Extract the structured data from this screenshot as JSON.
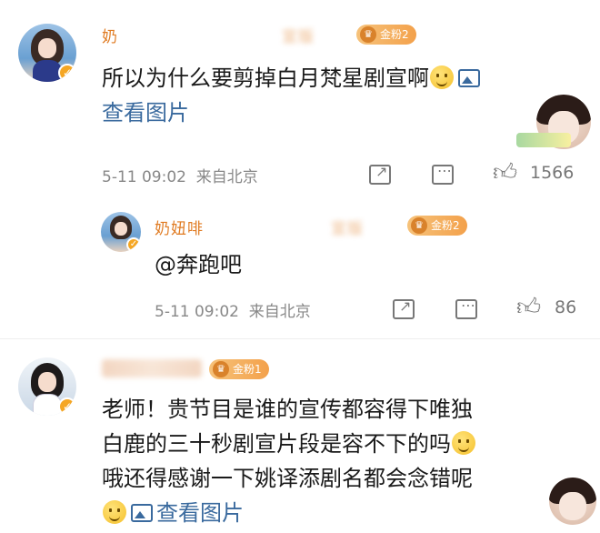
{
  "comments": [
    {
      "username": "奶",
      "username_hidden": "宣版",
      "fan_badge": "金粉2",
      "text": "所以为什么要剪掉白月梵星剧宣啊",
      "view_image": "查看图片",
      "time": "5-11 09:02",
      "source": "来自北京",
      "likes": "1566"
    },
    {
      "username": "奶妞啡",
      "username_hidden": "宣版",
      "fan_badge": "金粉2",
      "mention": "@奔跑吧",
      "time": "5-11 09:02",
      "source": "来自北京",
      "likes": "86"
    },
    {
      "username": "",
      "fan_badge": "金粉1",
      "line1": "老师！贵节目是谁的宣传都容得下唯独",
      "line2": "白鹿的三十秒剧宣片段是容不下的吗",
      "line3": "哦还得感谢一下姚译添剧名都会念错呢",
      "view_image": "查看图片"
    }
  ],
  "icons": [
    "verified-icon",
    "image-icon",
    "forward-icon",
    "reply-icon",
    "like-icon",
    "emoji-icon"
  ],
  "colors": {
    "username": "#e07b22",
    "link": "#3a6a9e",
    "meta": "#888888",
    "badge": "#f3a14b"
  }
}
